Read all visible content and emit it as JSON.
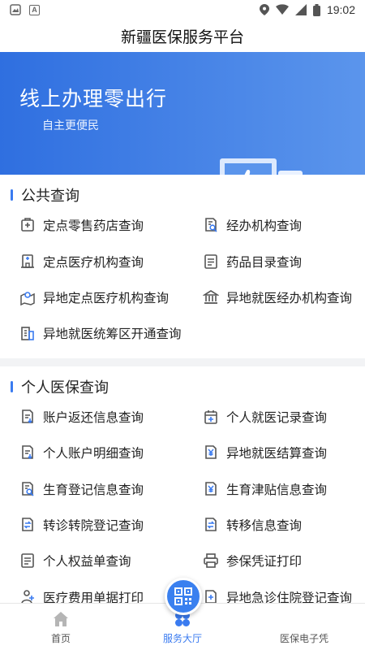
{
  "status": {
    "time": "19:02"
  },
  "app": {
    "title": "新疆医保服务平台"
  },
  "banner": {
    "title": "线上办理零出行",
    "subtitle": "自主更便民"
  },
  "public_query": {
    "title": "公共查询",
    "items": [
      {
        "label": "定点零售药店查询",
        "icon": "pharmacy-icon"
      },
      {
        "label": "经办机构查询",
        "icon": "doc-search-icon"
      },
      {
        "label": "定点医疗机构查询",
        "icon": "hospital-icon"
      },
      {
        "label": "药品目录查询",
        "icon": "list-icon"
      },
      {
        "label": "异地定点医疗机构查询",
        "icon": "map-pin-icon"
      },
      {
        "label": "异地就医经办机构查询",
        "icon": "bank-icon"
      },
      {
        "label": "异地就医统筹区开通查询",
        "icon": "building-icon"
      }
    ]
  },
  "personal_query": {
    "title": "个人医保查询",
    "items": [
      {
        "label": "账户返还信息查询",
        "icon": "doc-down-icon"
      },
      {
        "label": "个人就医记录查询",
        "icon": "calendar-plus-icon"
      },
      {
        "label": "个人账户明细查询",
        "icon": "doc-down-icon"
      },
      {
        "label": "异地就医结算查询",
        "icon": "yen-doc-icon"
      },
      {
        "label": "生育登记信息查询",
        "icon": "doc-search-icon"
      },
      {
        "label": "生育津贴信息查询",
        "icon": "yen-doc-icon"
      },
      {
        "label": "转诊转院登记查询",
        "icon": "transfer-doc-icon"
      },
      {
        "label": "转移信息查询",
        "icon": "transfer-doc-icon"
      },
      {
        "label": "个人权益单查询",
        "icon": "list-icon"
      },
      {
        "label": "参保凭证打印",
        "icon": "printer-icon"
      },
      {
        "label": "医疗费用单据打印",
        "icon": "medical-icon"
      },
      {
        "label": "异地急诊住院登记查询",
        "icon": "plus-doc-icon"
      }
    ]
  },
  "tabs": [
    {
      "label": "首页",
      "icon": "home-icon",
      "active": false
    },
    {
      "label": "服务大厅",
      "icon": "service-icon",
      "active": true
    },
    {
      "label": "医保电子凭",
      "icon": "qr-code-icon",
      "active": false
    }
  ],
  "colors": {
    "accent": "#3a7bf0",
    "banner": "#2f6fe0"
  }
}
